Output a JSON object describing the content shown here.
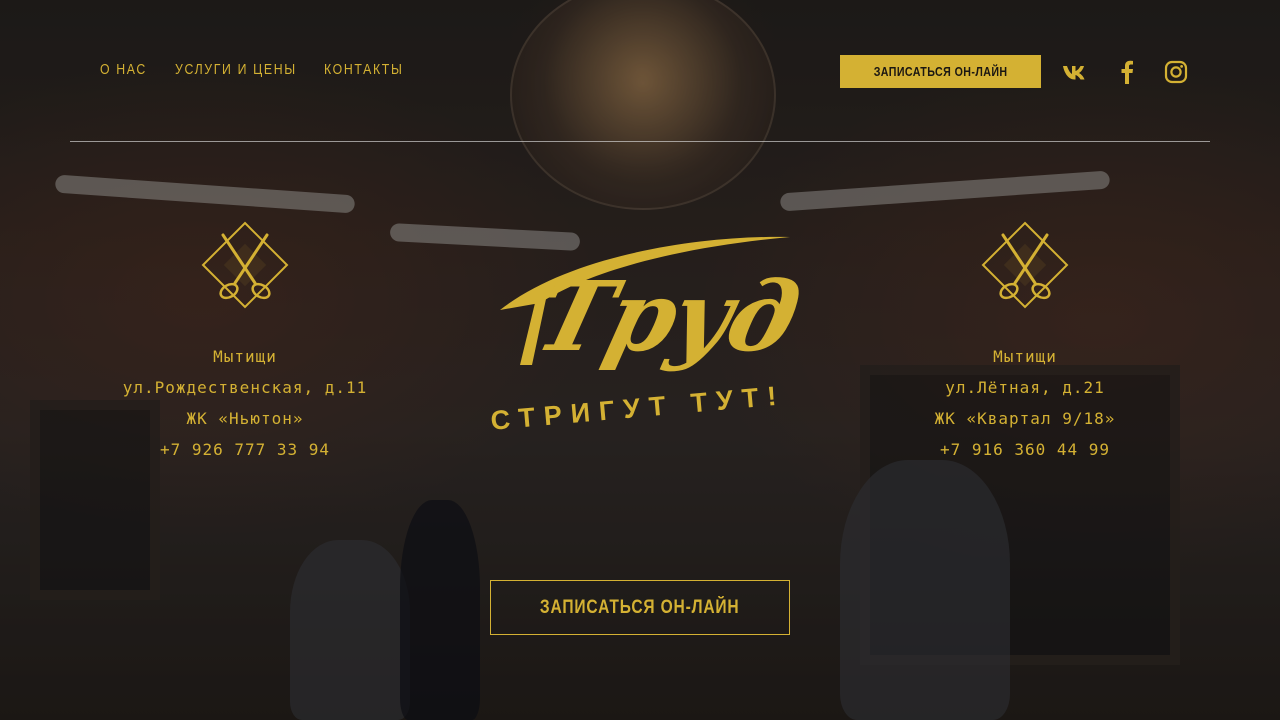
{
  "nav": {
    "items": [
      {
        "label": "О НАС"
      },
      {
        "label": "УСЛУГИ И ЦЕНЫ"
      },
      {
        "label": "КОНТАКТЫ"
      }
    ]
  },
  "header": {
    "book_button_label": "ЗАПИСАТЬСЯ ОН-ЛАЙН",
    "social": [
      {
        "icon": "vk-icon"
      },
      {
        "icon": "facebook-icon"
      },
      {
        "icon": "instagram-icon"
      }
    ]
  },
  "brand": {
    "logo_text": "Труд",
    "tagline": "СТРИГУТ ТУТ!",
    "accent_color": "#d4b133"
  },
  "locations": [
    {
      "city": "Мытищи",
      "street": "ул.Рождественская, д.11",
      "complex": "ЖК «Ньютон»",
      "phone": "+7 926 777 33 94"
    },
    {
      "city": "Мытищи",
      "street": "ул.Лётная, д.21",
      "complex": "ЖК «Квартал 9/18»",
      "phone": "+7 916 360 44 99"
    }
  ],
  "main_cta": {
    "label": "ЗАПИСАТЬСЯ ОН-ЛАЙН"
  }
}
